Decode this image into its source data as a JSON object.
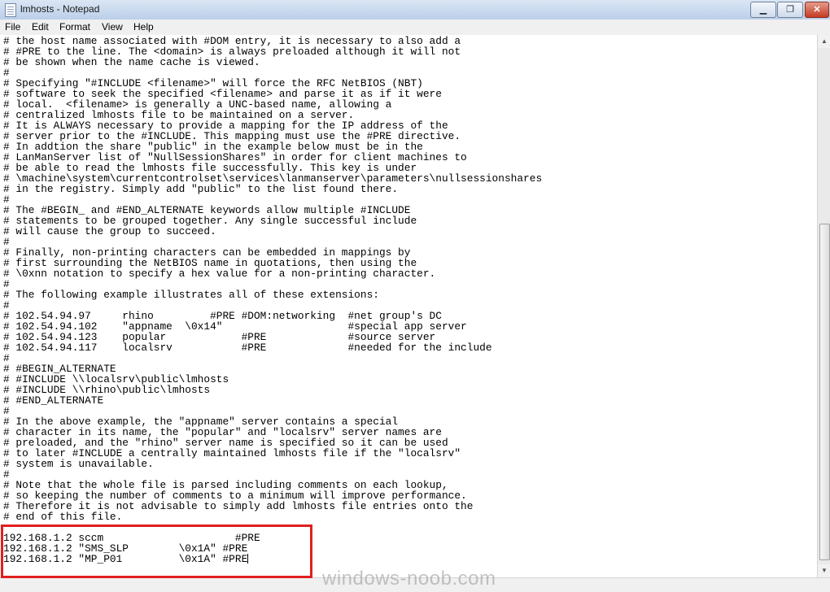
{
  "window": {
    "title": "lmhosts - Notepad",
    "minimize_label": "▁",
    "maximize_label": "❐",
    "close_label": "✕"
  },
  "menu": [
    "File",
    "Edit",
    "Format",
    "View",
    "Help"
  ],
  "editor": {
    "lines": [
      "# the host name associated with #DOM entry, it is necessary to also add a",
      "# #PRE to the line. The <domain> is always preloaded although it will not",
      "# be shown when the name cache is viewed.",
      "#",
      "# Specifying \"#INCLUDE <filename>\" will force the RFC NetBIOS (NBT)",
      "# software to seek the specified <filename> and parse it as if it were",
      "# local.  <filename> is generally a UNC-based name, allowing a",
      "# centralized lmhosts file to be maintained on a server.",
      "# It is ALWAYS necessary to provide a mapping for the IP address of the",
      "# server prior to the #INCLUDE. This mapping must use the #PRE directive.",
      "# In addtion the share \"public\" in the example below must be in the",
      "# LanManServer list of \"NullSessionShares\" in order for client machines to",
      "# be able to read the lmhosts file successfully. This key is under",
      "# \\machine\\system\\currentcontrolset\\services\\lanmanserver\\parameters\\nullsessionshares",
      "# in the registry. Simply add \"public\" to the list found there.",
      "#",
      "# The #BEGIN_ and #END_ALTERNATE keywords allow multiple #INCLUDE",
      "# statements to be grouped together. Any single successful include",
      "# will cause the group to succeed.",
      "#",
      "# Finally, non-printing characters can be embedded in mappings by",
      "# first surrounding the NetBIOS name in quotations, then using the",
      "# \\0xnn notation to specify a hex value for a non-printing character.",
      "#",
      "# The following example illustrates all of these extensions:",
      "#",
      "# 102.54.94.97     rhino         #PRE #DOM:networking  #net group's DC",
      "# 102.54.94.102    \"appname  \\0x14\"                    #special app server",
      "# 102.54.94.123    popular            #PRE             #source server",
      "# 102.54.94.117    localsrv           #PRE             #needed for the include",
      "#",
      "# #BEGIN_ALTERNATE",
      "# #INCLUDE \\\\localsrv\\public\\lmhosts",
      "# #INCLUDE \\\\rhino\\public\\lmhosts",
      "# #END_ALTERNATE",
      "#",
      "# In the above example, the \"appname\" server contains a special",
      "# character in its name, the \"popular\" and \"localsrv\" server names are",
      "# preloaded, and the \"rhino\" server name is specified so it can be used",
      "# to later #INCLUDE a centrally maintained lmhosts file if the \"localsrv\"",
      "# system is unavailable.",
      "#",
      "# Note that the whole file is parsed including comments on each lookup,",
      "# so keeping the number of comments to a minimum will improve performance.",
      "# Therefore it is not advisable to simply add lmhosts file entries onto the",
      "# end of this file.",
      "",
      "192.168.1.2 sccm                     #PRE",
      "192.168.1.2 \"SMS_SLP        \\0x1A\" #PRE",
      "192.168.1.2 \"MP_P01         \\0x1A\" #PRE"
    ]
  },
  "watermark": "windows-noob.com",
  "colors": {
    "highlight_box": "#e01f1f",
    "titlebar": "#c9d9ee"
  }
}
